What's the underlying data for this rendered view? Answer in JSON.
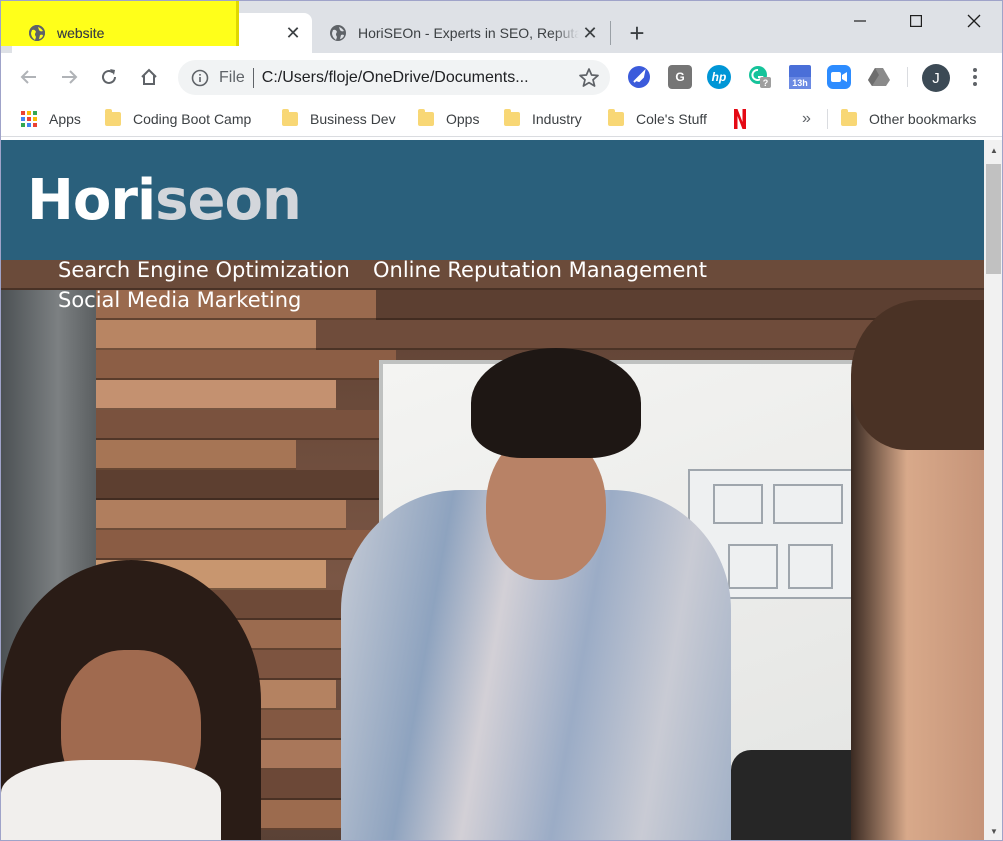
{
  "browser": {
    "tabs": [
      {
        "title": "website",
        "active": true
      },
      {
        "title": "HoriSEOn - Experts in SEO, Reputation Management",
        "active": false
      }
    ],
    "new_tab_symbol": "+",
    "window_controls": {
      "minimize": "─",
      "maximize": "☐",
      "close": "✕"
    },
    "address": {
      "scheme": "File",
      "url": "C:/Users/floje/OneDrive/Documents..."
    },
    "extensions": [
      {
        "name": "rocket-extension-icon",
        "color": "#3b5bdb"
      },
      {
        "name": "g-extension-icon",
        "label": "G",
        "color": "#757575"
      },
      {
        "name": "hp-extension-icon",
        "label": "hp",
        "color": "#0096d6"
      },
      {
        "name": "grammarly-extension-icon",
        "color": "#15c39a"
      },
      {
        "name": "calendar-extension-icon",
        "label": "13h",
        "color": "#4a6fd8"
      },
      {
        "name": "zoom-extension-icon",
        "color": "#2d8cff"
      },
      {
        "name": "drive-extension-icon",
        "color": "#8a8a8a"
      }
    ],
    "avatar_initial": "J",
    "bookmarks": [
      {
        "label": "Apps",
        "icon": "apps-grid-icon"
      },
      {
        "label": "Coding Boot Camp",
        "icon": "folder-icon"
      },
      {
        "label": "Business Dev",
        "icon": "folder-icon"
      },
      {
        "label": "Opps",
        "icon": "folder-icon"
      },
      {
        "label": "Industry",
        "icon": "folder-icon"
      },
      {
        "label": "Cole's Stuff",
        "icon": "folder-icon"
      },
      {
        "label": "",
        "icon": "netflix-icon"
      }
    ],
    "bookmarks_overflow": "»",
    "other_bookmarks": "Other bookmarks"
  },
  "site": {
    "logo_main": "Hori",
    "logo_accent": "seon",
    "nav": [
      "Search Engine Optimization",
      "Online Reputation Management",
      "Social Media Marketing"
    ]
  },
  "colors": {
    "header_bg": "#2a607c",
    "highlight": "#ffff1a",
    "tabstrip": "#dee1e6"
  }
}
